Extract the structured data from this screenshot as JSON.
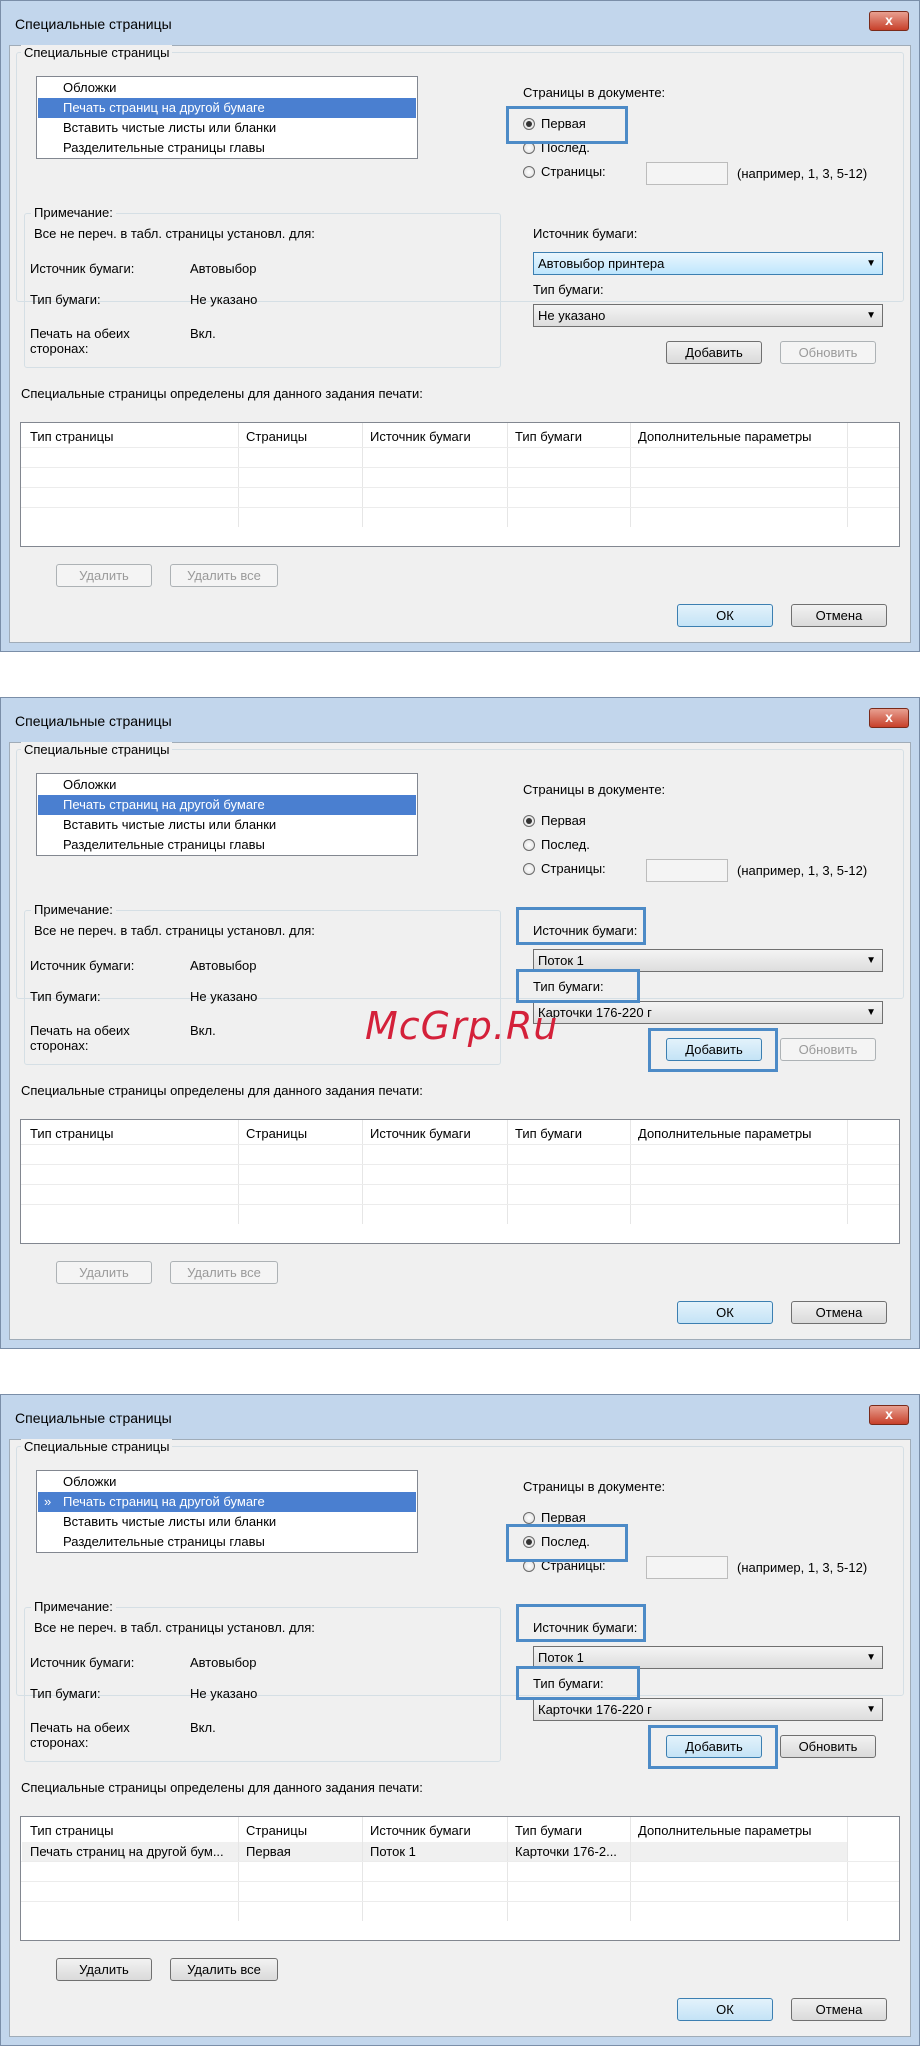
{
  "watermark": "McGrp.Ru",
  "dialogs": [
    {
      "title": "Специальные страницы",
      "close": "x",
      "group_title": "Специальные страницы",
      "list": [
        {
          "label": "Обложки",
          "mark": ""
        },
        {
          "label": "Печать страниц на другой бумаге",
          "mark": ""
        },
        {
          "label": "Вставить чистые листы или бланки",
          "mark": ""
        },
        {
          "label": "Разделительные страницы главы",
          "mark": ""
        }
      ],
      "pages_label": "Страницы в документе:",
      "radios": [
        "Первая",
        "Послед.",
        "Страницы:"
      ],
      "pages_hint": "(например, 1, 3, 5-12)",
      "note_title": "Примечание:",
      "note_text": "Все не переч. в  табл. страницы установл. для:",
      "note_rows": [
        {
          "label": "Источник бумаги:",
          "value": "Автовыбор"
        },
        {
          "label": "Тип бумаги:",
          "value": "Не указано"
        },
        {
          "label": "Печать на обеих сторонах:",
          "value": "Вкл."
        }
      ],
      "source_label": "Источник бумаги:",
      "source_value": "Автовыбор принтера",
      "type_label": "Тип бумаги:",
      "type_value": "Не указано",
      "add": "Добавить",
      "update": "Обновить",
      "table_caption": "Специальные страницы определены для данного задания печати:",
      "columns": [
        "Тип страницы",
        "Страницы",
        "Источник бумаги",
        "Тип бумаги",
        "Дополнительные параметры"
      ],
      "rows": [],
      "delete": "Удалить",
      "delete_all": "Удалить все",
      "ok": "ОК",
      "cancel": "Отмена"
    },
    {
      "title": "Специальные страницы",
      "close": "x",
      "group_title": "Специальные страницы",
      "list": [
        {
          "label": "Обложки",
          "mark": ""
        },
        {
          "label": "Печать страниц на другой бумаге",
          "mark": ""
        },
        {
          "label": "Вставить чистые листы или бланки",
          "mark": ""
        },
        {
          "label": "Разделительные страницы главы",
          "mark": ""
        }
      ],
      "pages_label": "Страницы в документе:",
      "radios": [
        "Первая",
        "Послед.",
        "Страницы:"
      ],
      "pages_hint": "(например, 1, 3, 5-12)",
      "note_title": "Примечание:",
      "note_text": "Все не переч. в  табл. страницы установл. для:",
      "note_rows": [
        {
          "label": "Источник бумаги:",
          "value": "Автовыбор"
        },
        {
          "label": "Тип бумаги:",
          "value": "Не указано"
        },
        {
          "label": "Печать на обеих сторонах:",
          "value": "Вкл."
        }
      ],
      "source_label": "Источник бумаги:",
      "source_value": "Поток 1",
      "type_label": "Тип бумаги:",
      "type_value": "Карточки 176-220 г",
      "add": "Добавить",
      "update": "Обновить",
      "table_caption": "Специальные страницы определены для данного задания печати:",
      "columns": [
        "Тип страницы",
        "Страницы",
        "Источник бумаги",
        "Тип бумаги",
        "Дополнительные параметры"
      ],
      "rows": [],
      "delete": "Удалить",
      "delete_all": "Удалить все",
      "ok": "ОК",
      "cancel": "Отмена"
    },
    {
      "title": "Специальные страницы",
      "close": "x",
      "group_title": "Специальные страницы",
      "list": [
        {
          "label": "Обложки",
          "mark": ""
        },
        {
          "label": "Печать страниц на другой бумаге",
          "mark": "»"
        },
        {
          "label": "Вставить чистые листы или бланки",
          "mark": ""
        },
        {
          "label": "Разделительные страницы главы",
          "mark": ""
        }
      ],
      "pages_label": "Страницы в документе:",
      "radios": [
        "Первая",
        "Послед.",
        "Страницы:"
      ],
      "pages_hint": "(например, 1, 3, 5-12)",
      "note_title": "Примечание:",
      "note_text": "Все не переч. в  табл. страницы установл. для:",
      "note_rows": [
        {
          "label": "Источник бумаги:",
          "value": "Автовыбор"
        },
        {
          "label": "Тип бумаги:",
          "value": "Не указано"
        },
        {
          "label": "Печать на обеих сторонах:",
          "value": "Вкл."
        }
      ],
      "source_label": "Источник бумаги:",
      "source_value": "Поток 1",
      "type_label": "Тип бумаги:",
      "type_value": "Карточки 176-220 г",
      "add": "Добавить",
      "update": "Обновить",
      "table_caption": "Специальные страницы определены для данного задания печати:",
      "columns": [
        "Тип страницы",
        "Страницы",
        "Источник бумаги",
        "Тип бумаги",
        "Дополнительные параметры"
      ],
      "rows": [
        {
          "type": "Печать страниц на другой бум...",
          "pages": "Первая",
          "source": "Поток 1",
          "paper": "Карточки 176-2..."
        }
      ],
      "delete": "Удалить",
      "delete_all": "Удалить все",
      "ok": "ОК",
      "cancel": "Отмена"
    }
  ]
}
